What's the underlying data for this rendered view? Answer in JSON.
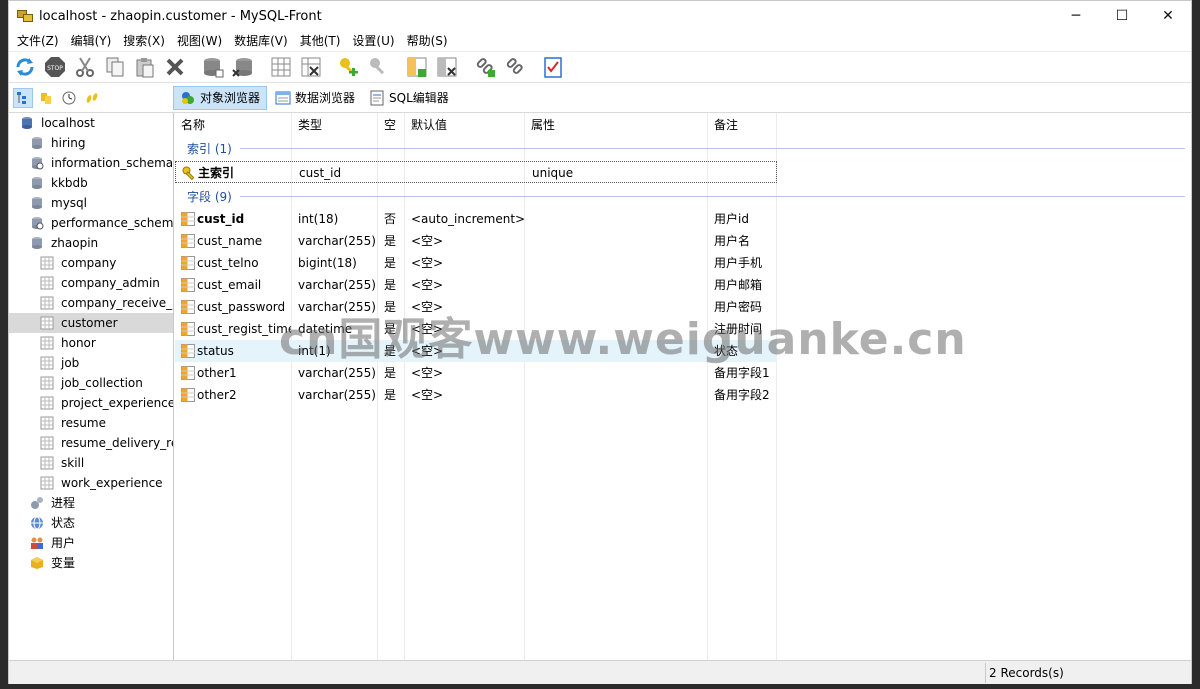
{
  "window": {
    "title": "localhost - zhaopin.customer - MySQL-Front",
    "controls": [
      "─",
      "☐",
      "✕"
    ]
  },
  "menu": [
    "文件(Z)",
    "编辑(Y)",
    "搜索(X)",
    "视图(W)",
    "数据库(V)",
    "其他(T)",
    "设置(U)",
    "帮助(S)"
  ],
  "toolbar_icons": [
    "refresh-icon",
    "stop-icon",
    "cut-icon",
    "copy-icon",
    "paste-icon",
    "delete-icon",
    "database-add-icon",
    "database-delete-icon",
    "table-add-icon",
    "table-delete-icon",
    "key-add-icon",
    "key-delete-icon",
    "column-add-icon",
    "column-delete-icon",
    "link-add-icon",
    "link-delete-icon",
    "checklist-icon"
  ],
  "view_tabs": [
    "对象浏览器",
    "数据浏览器",
    "SQL编辑器"
  ],
  "tree": {
    "root": "localhost",
    "databases": [
      "hiring",
      "information_schema",
      "kkbdb",
      "mysql",
      "performance_schema",
      "zhaopin"
    ],
    "zhaopin_tables": [
      "company",
      "company_admin",
      "company_receive_re",
      "customer",
      "honor",
      "job",
      "job_collection",
      "project_experience",
      "resume",
      "resume_delivery_re",
      "skill",
      "work_experience"
    ],
    "selected": "customer",
    "others": [
      "进程",
      "状态",
      "用户",
      "变量"
    ]
  },
  "columns": [
    "名称",
    "类型",
    "空",
    "默认值",
    "属性",
    "备注"
  ],
  "index_group": {
    "label": "索引 (1)",
    "rows": [
      {
        "name": "主索引",
        "type": "cust_id",
        "attribute": "unique"
      }
    ]
  },
  "field_group": {
    "label": "字段 (9)",
    "rows": [
      {
        "name": "cust_id",
        "type": "int(18)",
        "null": "否",
        "default": "<auto_increment>",
        "attribute": "",
        "comment": "用户id",
        "bold": true
      },
      {
        "name": "cust_name",
        "type": "varchar(255)",
        "null": "是",
        "default": "<空>",
        "attribute": "",
        "comment": "用户名"
      },
      {
        "name": "cust_telno",
        "type": "bigint(18)",
        "null": "是",
        "default": "<空>",
        "attribute": "",
        "comment": "用户手机"
      },
      {
        "name": "cust_email",
        "type": "varchar(255)",
        "null": "是",
        "default": "<空>",
        "attribute": "",
        "comment": "用户邮箱"
      },
      {
        "name": "cust_password",
        "type": "varchar(255)",
        "null": "是",
        "default": "<空>",
        "attribute": "",
        "comment": "用户密码"
      },
      {
        "name": "cust_regist_time",
        "type": "datetime",
        "null": "是",
        "default": "<空>",
        "attribute": "",
        "comment": "注册时间"
      },
      {
        "name": "status",
        "type": "int(1)",
        "null": "是",
        "default": "<空>",
        "attribute": "",
        "comment": "状态",
        "highlight": true
      },
      {
        "name": "other1",
        "type": "varchar(255)",
        "null": "是",
        "default": "<空>",
        "attribute": "",
        "comment": "备用字段1"
      },
      {
        "name": "other2",
        "type": "varchar(255)",
        "null": "是",
        "default": "<空>",
        "attribute": "",
        "comment": "备用字段2"
      }
    ]
  },
  "status_bar": {
    "records": "2 Records(s)"
  },
  "watermark": "cn国观客www.weiguanke.cn"
}
